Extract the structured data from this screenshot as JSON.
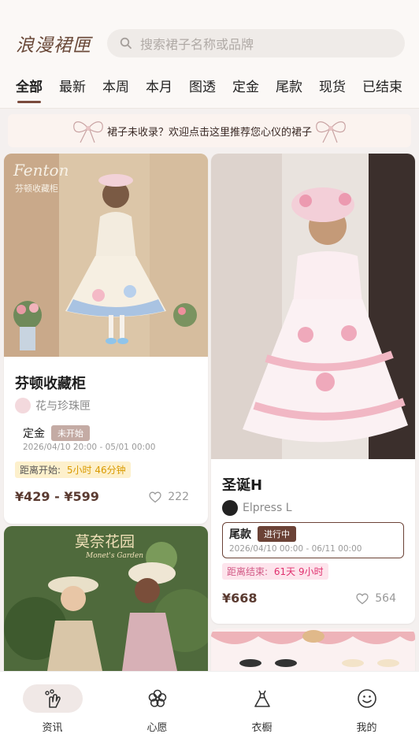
{
  "header": {
    "logo": "浪漫裙匣",
    "search_placeholder": "搜索裙子名称或品牌"
  },
  "tabs": [
    "全部",
    "最新",
    "本周",
    "本月",
    "图透",
    "定金",
    "尾款",
    "现货",
    "已结束"
  ],
  "banner": {
    "text": "裙子未收录？欢迎点击这里推荐您心仪的裙子"
  },
  "cards": [
    {
      "title": "芬顿收藏柜",
      "shop": "花与珍珠匣",
      "phase": "定金",
      "status": "未开始",
      "date": "2026/04/10 20:00 - 05/01 00:00",
      "countdown_label": "距离开始:",
      "countdown_value": "5小时 46分钟",
      "price": "¥429 - ¥599",
      "likes": "222",
      "image_caption": "Fenton 芬顿收藏柜"
    },
    {
      "title": "圣诞H",
      "shop": "Elpress L",
      "phase": "尾款",
      "status": "进行中",
      "date": "2026/04/10 00:00 - 06/11 00:00",
      "countdown_label": "距离结束:",
      "countdown_value": "61天 9小时",
      "price": "¥668",
      "likes": "564"
    },
    {
      "image_caption": "莫奈花园 Monet's Garden"
    }
  ],
  "bottom_nav": [
    {
      "label": "资讯",
      "icon": "news-hand-icon",
      "active": true
    },
    {
      "label": "心愿",
      "icon": "wish-flower-icon",
      "active": false
    },
    {
      "label": "衣橱",
      "icon": "wardrobe-dress-icon",
      "active": false
    },
    {
      "label": "我的",
      "icon": "profile-smile-icon",
      "active": false
    }
  ],
  "colors": {
    "accent": "#7a4a3c",
    "pending_badge": "#c4aba4",
    "active_badge": "#6b4236",
    "countdown_start_bg": "#fdf0cc",
    "countdown_end_bg": "#fde4ec"
  }
}
